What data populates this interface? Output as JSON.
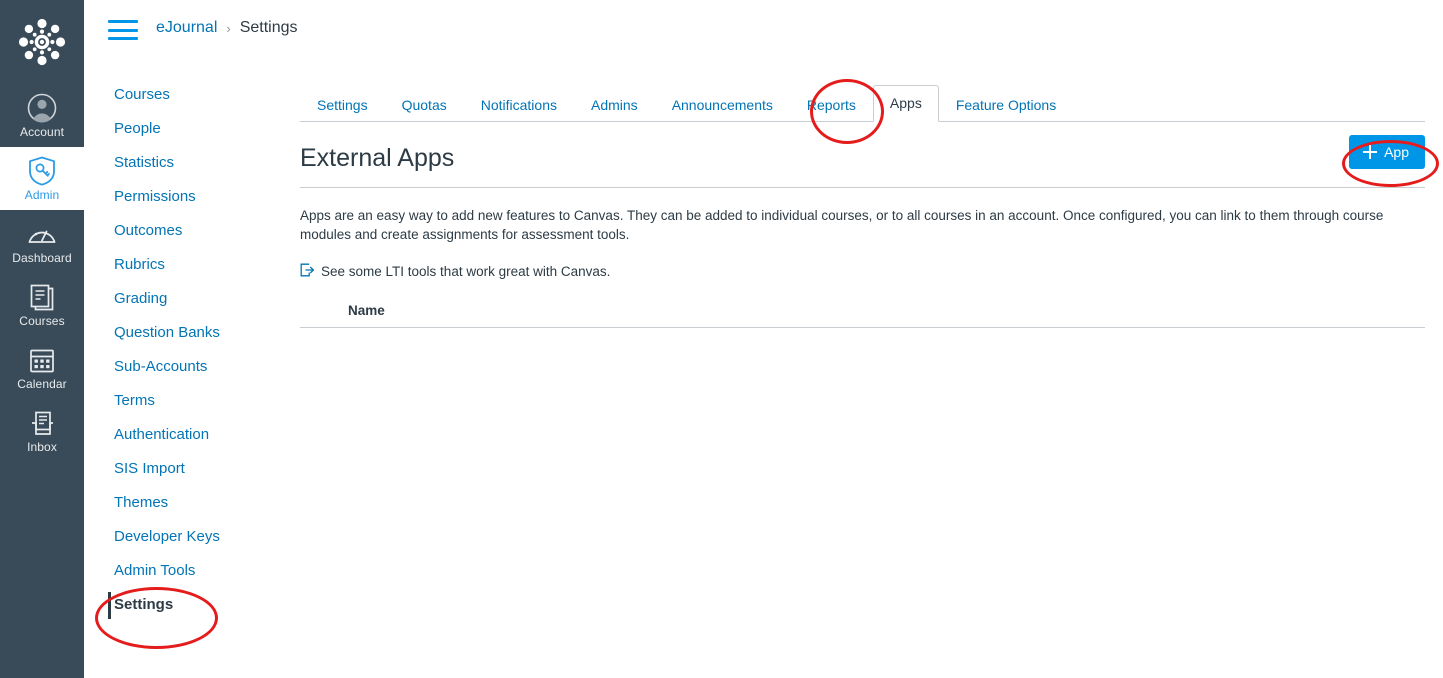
{
  "globalnav": {
    "logo_icon": "canvas-logo-icon",
    "items": [
      {
        "label": "Account",
        "icon": "user-avatar-icon",
        "active": false
      },
      {
        "label": "Admin",
        "icon": "shield-key-icon",
        "active": true
      },
      {
        "label": "Dashboard",
        "icon": "dashboard-gauge-icon",
        "active": false
      },
      {
        "label": "Courses",
        "icon": "book-icon",
        "active": false
      },
      {
        "label": "Calendar",
        "icon": "calendar-icon",
        "active": false
      },
      {
        "label": "Inbox",
        "icon": "inbox-tray-icon",
        "active": false
      }
    ]
  },
  "header": {
    "menu_icon": "hamburger-menu-icon",
    "breadcrumb": {
      "root": "eJournal",
      "separator": "›",
      "current": "Settings"
    }
  },
  "sidebar": {
    "items": [
      {
        "label": "Courses",
        "active": false
      },
      {
        "label": "People",
        "active": false
      },
      {
        "label": "Statistics",
        "active": false
      },
      {
        "label": "Permissions",
        "active": false
      },
      {
        "label": "Outcomes",
        "active": false
      },
      {
        "label": "Rubrics",
        "active": false
      },
      {
        "label": "Grading",
        "active": false
      },
      {
        "label": "Question Banks",
        "active": false
      },
      {
        "label": "Sub-Accounts",
        "active": false
      },
      {
        "label": "Terms",
        "active": false
      },
      {
        "label": "Authentication",
        "active": false
      },
      {
        "label": "SIS Import",
        "active": false
      },
      {
        "label": "Themes",
        "active": false
      },
      {
        "label": "Developer Keys",
        "active": false
      },
      {
        "label": "Admin Tools",
        "active": false
      },
      {
        "label": "Settings",
        "active": true
      }
    ]
  },
  "tabs": [
    {
      "label": "Settings",
      "active": false
    },
    {
      "label": "Quotas",
      "active": false
    },
    {
      "label": "Notifications",
      "active": false
    },
    {
      "label": "Admins",
      "active": false
    },
    {
      "label": "Announcements",
      "active": false
    },
    {
      "label": "Reports",
      "active": false
    },
    {
      "label": "Apps",
      "active": true
    },
    {
      "label": "Feature Options",
      "active": false
    }
  ],
  "main": {
    "title": "External Apps",
    "add_app_label": "App",
    "add_app_icon": "plus-icon",
    "description": "Apps are an easy way to add new features to Canvas. They can be added to individual courses, or to all courses in an account. Once configured, you can link to them through course modules and create assignments for assessment tools.",
    "lti_link": {
      "icon": "external-link-icon",
      "text": "See some LTI tools that work great with Canvas."
    },
    "table": {
      "columns": [
        "Name"
      ],
      "rows": []
    }
  },
  "annotations": [
    {
      "name": "apps-tab-highlight",
      "shape": "ellipse",
      "color": "#E51C1C"
    },
    {
      "name": "add-app-button-highlight",
      "shape": "ellipse",
      "color": "#E51C1C"
    },
    {
      "name": "settings-nav-highlight",
      "shape": "ellipse",
      "color": "#E51C1C"
    }
  ],
  "colors": {
    "brand_blue": "#0374B5",
    "button_blue": "#0096E8",
    "nav_dark": "#394B58",
    "text_dark": "#2D3B45",
    "border_gray": "#C7CDD1",
    "annotation_red": "#E51C1C"
  }
}
